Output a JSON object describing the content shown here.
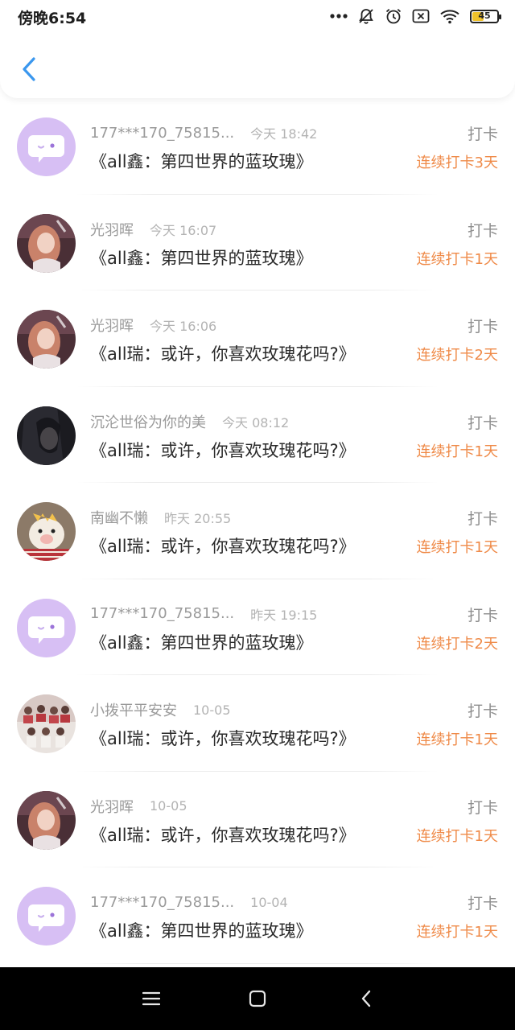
{
  "status_bar": {
    "time": "傍晚6:54",
    "battery_level": "45",
    "icons": [
      "more-dots-icon",
      "mute-bell-icon",
      "alarm-icon",
      "close-box-icon",
      "wifi-icon",
      "battery-icon"
    ]
  },
  "header": {
    "back_icon": "chevron-left-icon"
  },
  "colors": {
    "accent": "#3a97ee",
    "streak": "#ef8a48",
    "avatar_bg": "#d7bff4"
  },
  "records": [
    {
      "user": "177***170_75815...",
      "time": "今天 18:42",
      "title": "《all鑫：第四世界的蓝玫瑰》",
      "action": "打卡",
      "streak": "连续打卡3天",
      "avatar": "default"
    },
    {
      "user": "光羽晖",
      "time": "今天 16:07",
      "title": "《all鑫：第四世界的蓝玫瑰》",
      "action": "打卡",
      "streak": "连续打卡1天",
      "avatar": "photo-girl"
    },
    {
      "user": "光羽晖",
      "time": "今天 16:06",
      "title": "《all瑞：或许，你喜欢玫瑰花吗?》",
      "action": "打卡",
      "streak": "连续打卡2天",
      "avatar": "photo-girl"
    },
    {
      "user": "沉沦世俗为你的美",
      "time": "今天 08:12",
      "title": "《all瑞：或许，你喜欢玫瑰花吗?》",
      "action": "打卡",
      "streak": "连续打卡1天",
      "avatar": "photo-dark"
    },
    {
      "user": "南幽不懒",
      "time": "昨天 20:55",
      "title": "《all瑞：或许，你喜欢玫瑰花吗?》",
      "action": "打卡",
      "streak": "连续打卡1天",
      "avatar": "photo-toy"
    },
    {
      "user": "177***170_75815...",
      "time": "昨天 19:15",
      "title": "《all鑫：第四世界的蓝玫瑰》",
      "action": "打卡",
      "streak": "连续打卡2天",
      "avatar": "default"
    },
    {
      "user": "小拨平平安安",
      "time": "10-05",
      "title": "《all瑞：或许，你喜欢玫瑰花吗?》",
      "action": "打卡",
      "streak": "连续打卡1天",
      "avatar": "photo-group"
    },
    {
      "user": "光羽晖",
      "time": "10-05",
      "title": "《all瑞：或许，你喜欢玫瑰花吗?》",
      "action": "打卡",
      "streak": "连续打卡1天",
      "avatar": "photo-girl"
    },
    {
      "user": "177***170_75815...",
      "time": "10-04",
      "title": "《all鑫：第四世界的蓝玫瑰》",
      "action": "打卡",
      "streak": "连续打卡1天",
      "avatar": "default"
    }
  ],
  "nav_bar": {
    "icons": [
      "menu-icon",
      "home-square-icon",
      "back-triangle-icon"
    ]
  }
}
